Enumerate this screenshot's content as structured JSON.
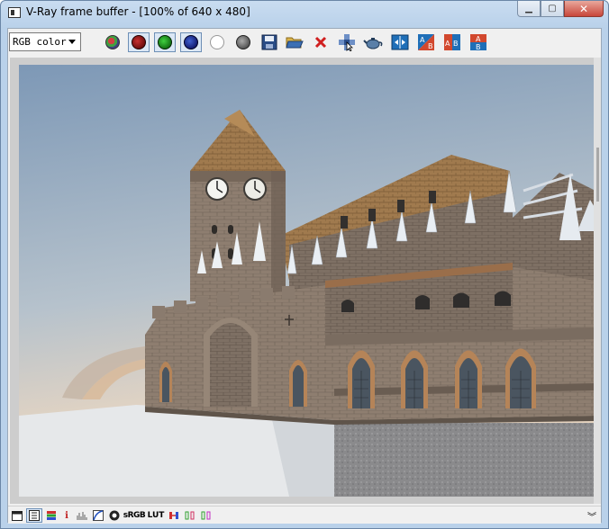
{
  "window": {
    "title": "V-Ray frame buffer - [100% of 640 x 480]",
    "minimize_glyph": "▁",
    "maximize_glyph": "▢",
    "close_glyph": "✕"
  },
  "toolbar": {
    "channel_value": "RGB color",
    "icons": [
      "rgb-view-icon",
      "red-channel-icon",
      "green-channel-icon",
      "blue-channel-icon",
      "alpha-channel-icon",
      "monochrome-icon",
      "save-image-icon",
      "load-image-icon",
      "clear-image-icon",
      "track-mouse-icon",
      "render-teapot-icon",
      "compare-icon",
      "ab-horizontal-icon",
      "ab-swap-icon",
      "ab-vertical-icon"
    ]
  },
  "render": {
    "width": 640,
    "height": 480,
    "zoom": "100%"
  },
  "statusbar": {
    "i_label": "i",
    "srgb_label": "sRGB",
    "lut_label": "LUT",
    "expand_glyph": "︾"
  },
  "colors": {
    "sky_top": "#7d98b6",
    "sky_bottom": "#e8d6c2",
    "stone": "#8a7a6c",
    "roof": "#a07a4e",
    "accent_red": "#c8463a"
  }
}
